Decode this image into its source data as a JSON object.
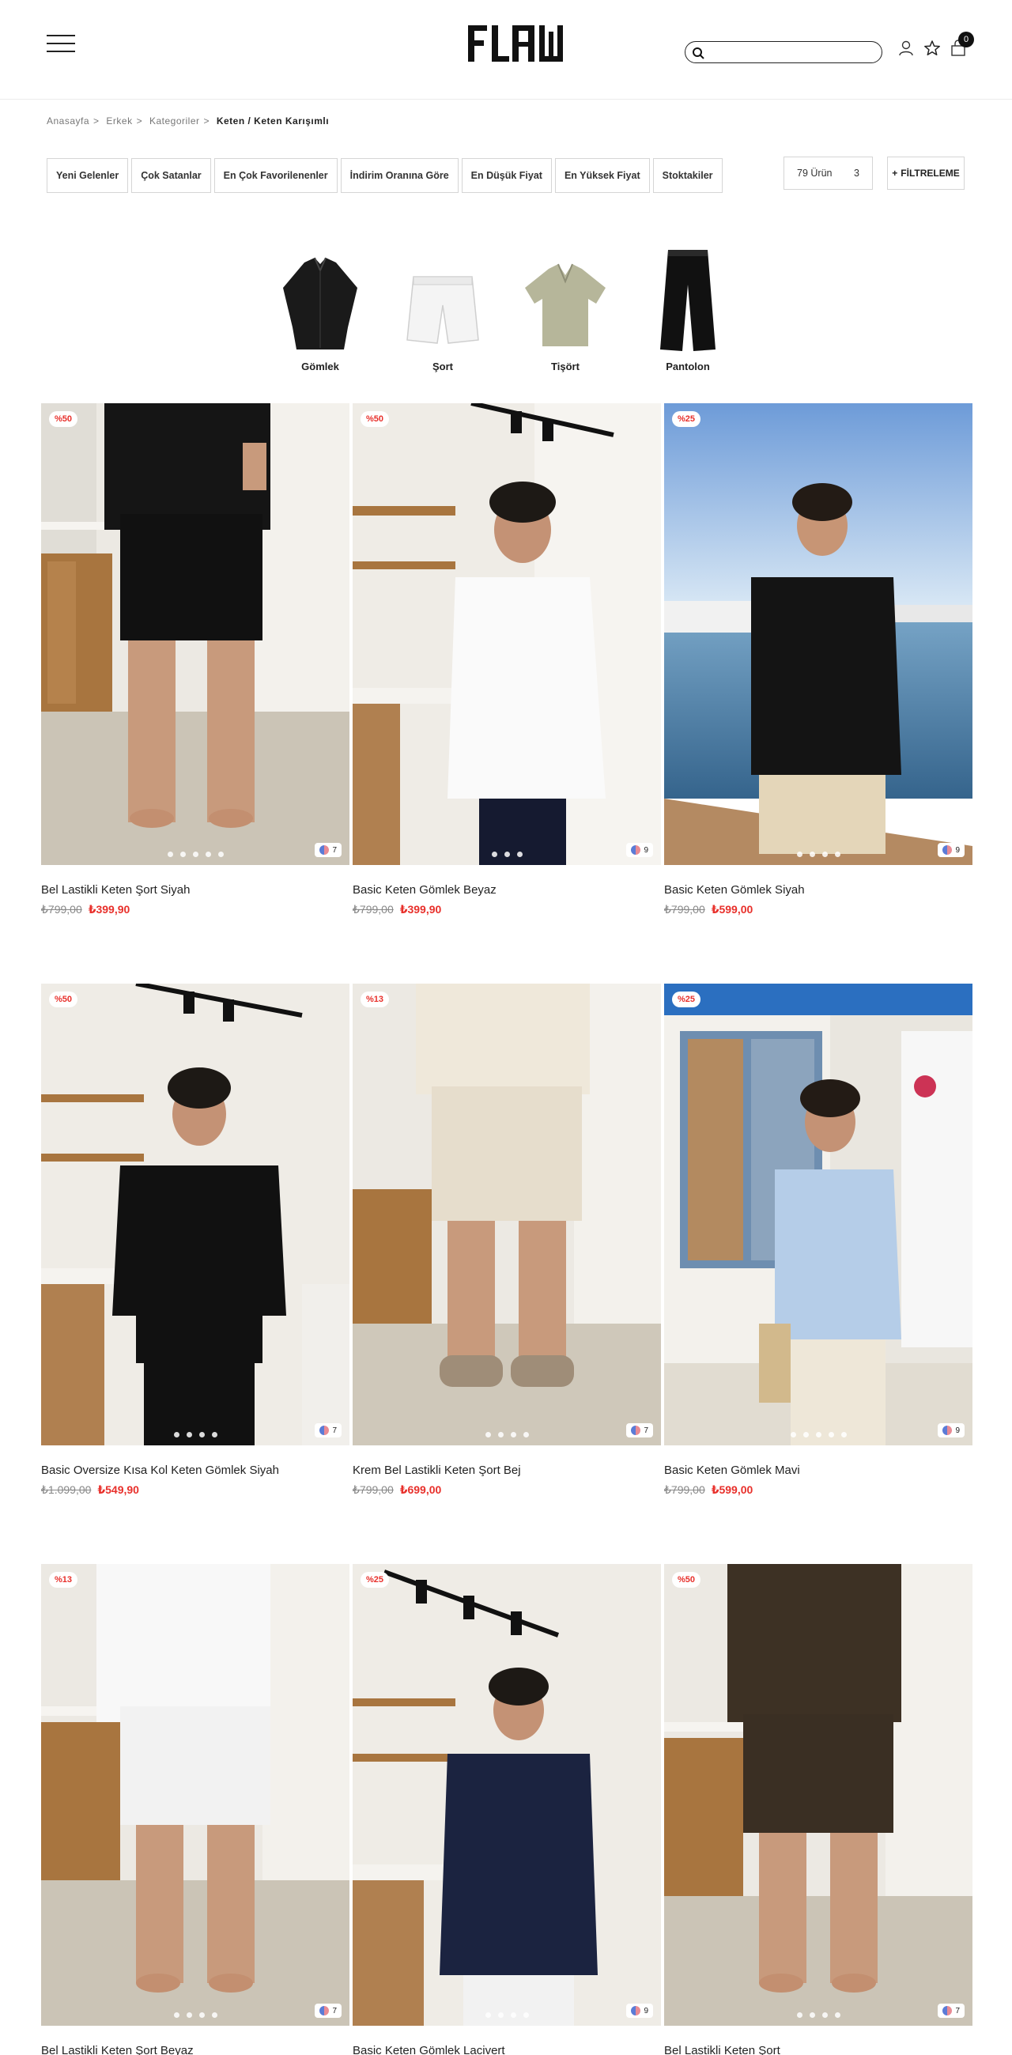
{
  "header": {
    "search_placeholder": "",
    "cart_count": "0"
  },
  "breadcrumb": {
    "items": [
      "Anasayfa",
      "Erkek",
      "Kategoriler"
    ],
    "current": "Keten / Keten Karışımlı",
    "separator": ">"
  },
  "sort": {
    "options": [
      "Yeni Gelenler",
      "Çok Satanlar",
      "En Çok Favorilenenler",
      "İndirim Oranına Göre",
      "En Düşük Fiyat",
      "En Yüksek Fiyat",
      "Stoktakiler"
    ],
    "count_label": "79 Ürün",
    "grid_columns": "3",
    "filter_label": "FİLTRELEME",
    "filter_prefix": "+"
  },
  "categories": [
    {
      "label": "Gömlek",
      "icon": "black-shirt-icon"
    },
    {
      "label": "Şort",
      "icon": "white-shorts-icon"
    },
    {
      "label": "Tişört",
      "icon": "beige-polo-icon"
    },
    {
      "label": "Pantolon",
      "icon": "black-trousers-icon"
    }
  ],
  "products": [
    {
      "name": "Bel Lastikli Keten Şort Siyah",
      "old_price": "₺799,00",
      "new_price": "₺399,90",
      "badge": "%50",
      "color_count": "7",
      "dots": 5
    },
    {
      "name": "Basic Keten Gömlek Beyaz",
      "old_price": "₺799,00",
      "new_price": "₺399,90",
      "badge": "%50",
      "color_count": "9",
      "dots": 3
    },
    {
      "name": "Basic Keten Gömlek Siyah",
      "old_price": "₺799,00",
      "new_price": "₺599,00",
      "badge": "%25",
      "color_count": "9",
      "dots": 4
    },
    {
      "name": "Basic Oversize Kısa Kol Keten Gömlek Siyah",
      "old_price": "₺1.099,00",
      "new_price": "₺549,90",
      "badge": "%50",
      "color_count": "7",
      "dots": 4
    },
    {
      "name": "Krem Bel Lastikli Keten Şort Bej",
      "old_price": "₺799,00",
      "new_price": "₺699,00",
      "badge": "%13",
      "color_count": "7",
      "dots": 4
    },
    {
      "name": "Basic Keten Gömlek Mavi",
      "old_price": "₺799,00",
      "new_price": "₺599,00",
      "badge": "%25",
      "color_count": "9",
      "dots": 5
    },
    {
      "name": "Bel Lastikli Keten Şort Beyaz",
      "old_price": "",
      "new_price": "",
      "badge": "%13",
      "color_count": "7",
      "dots": 4
    },
    {
      "name": "Basic Keten Gömlek Lacivert",
      "old_price": "",
      "new_price": "",
      "badge": "%25",
      "color_count": "9",
      "dots": 4
    },
    {
      "name": "Bel Lastikli Keten Şort",
      "old_price": "",
      "new_price": "",
      "badge": "%50",
      "color_count": "7",
      "dots": 4
    }
  ],
  "colors": {
    "accent_red": "#e8302b",
    "text_dark": "#222222"
  }
}
